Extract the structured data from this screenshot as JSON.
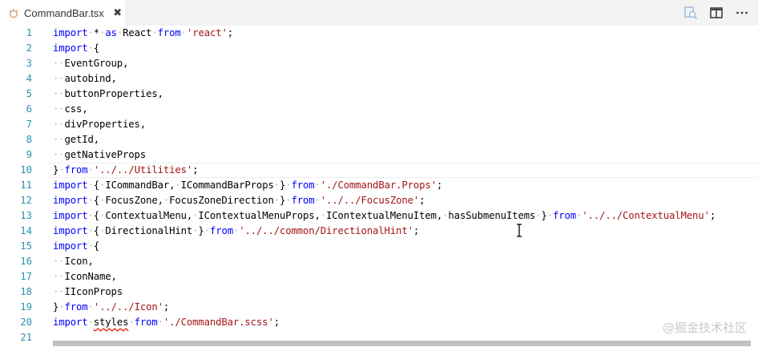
{
  "tab": {
    "label": "CommandBar.tsx",
    "close_glyph": "✖",
    "file_icon": "typescript-file-icon"
  },
  "actions": {
    "compare_icon": "open-changes-icon",
    "split_icon": "split-editor-icon"
  },
  "editor": {
    "lines": [
      {
        "n": "1",
        "tokens": [
          [
            "kw",
            "import"
          ],
          [
            "ws",
            "·"
          ],
          [
            "t",
            "*"
          ],
          [
            "ws",
            "·"
          ],
          [
            "kw",
            "as"
          ],
          [
            "ws",
            "·"
          ],
          [
            "t",
            "React"
          ],
          [
            "ws",
            "·"
          ],
          [
            "kw",
            "from"
          ],
          [
            "ws",
            "·"
          ],
          [
            "str",
            "'react'"
          ],
          [
            "t",
            ";"
          ]
        ]
      },
      {
        "n": "2",
        "tokens": [
          [
            "kw",
            "import"
          ],
          [
            "ws",
            "·"
          ],
          [
            "t",
            "{"
          ]
        ]
      },
      {
        "n": "3",
        "tokens": [
          [
            "ws",
            "··"
          ],
          [
            "t",
            "EventGroup,"
          ]
        ]
      },
      {
        "n": "4",
        "tokens": [
          [
            "ws",
            "··"
          ],
          [
            "t",
            "autobind,"
          ]
        ]
      },
      {
        "n": "5",
        "tokens": [
          [
            "ws",
            "··"
          ],
          [
            "t",
            "buttonProperties,"
          ]
        ]
      },
      {
        "n": "6",
        "tokens": [
          [
            "ws",
            "··"
          ],
          [
            "t",
            "css,"
          ]
        ]
      },
      {
        "n": "7",
        "tokens": [
          [
            "ws",
            "··"
          ],
          [
            "t",
            "divProperties,"
          ]
        ]
      },
      {
        "n": "8",
        "tokens": [
          [
            "ws",
            "··"
          ],
          [
            "t",
            "getId,"
          ]
        ]
      },
      {
        "n": "9",
        "tokens": [
          [
            "ws",
            "··"
          ],
          [
            "t",
            "getNativeProps"
          ]
        ]
      },
      {
        "n": "10",
        "tokens": [
          [
            "t",
            "}"
          ],
          [
            "ws",
            "·"
          ],
          [
            "kw",
            "from"
          ],
          [
            "ws",
            "·"
          ],
          [
            "str",
            "'../../Utilities'"
          ],
          [
            "t",
            ";"
          ]
        ]
      },
      {
        "n": "11",
        "tokens": [
          [
            "kw",
            "import"
          ],
          [
            "ws",
            "·"
          ],
          [
            "t",
            "{"
          ],
          [
            "ws",
            "·"
          ],
          [
            "t",
            "ICommandBar,"
          ],
          [
            "ws",
            "·"
          ],
          [
            "t",
            "ICommandBarProps"
          ],
          [
            "ws",
            "·"
          ],
          [
            "t",
            "}"
          ],
          [
            "ws",
            "·"
          ],
          [
            "kw",
            "from"
          ],
          [
            "ws",
            "·"
          ],
          [
            "str",
            "'./CommandBar.Props'"
          ],
          [
            "t",
            ";"
          ]
        ]
      },
      {
        "n": "12",
        "tokens": [
          [
            "kw",
            "import"
          ],
          [
            "ws",
            "·"
          ],
          [
            "t",
            "{"
          ],
          [
            "ws",
            "·"
          ],
          [
            "t",
            "FocusZone,"
          ],
          [
            "ws",
            "·"
          ],
          [
            "t",
            "FocusZoneDirection"
          ],
          [
            "ws",
            "·"
          ],
          [
            "t",
            "}"
          ],
          [
            "ws",
            "·"
          ],
          [
            "kw",
            "from"
          ],
          [
            "ws",
            "·"
          ],
          [
            "str",
            "'../../FocusZone'"
          ],
          [
            "t",
            ";"
          ]
        ]
      },
      {
        "n": "13",
        "tokens": [
          [
            "kw",
            "import"
          ],
          [
            "ws",
            "·"
          ],
          [
            "t",
            "{"
          ],
          [
            "ws",
            "·"
          ],
          [
            "t",
            "ContextualMenu,"
          ],
          [
            "ws",
            "·"
          ],
          [
            "t",
            "IContextualMenuProps,"
          ],
          [
            "ws",
            "·"
          ],
          [
            "t",
            "IContextualMenuItem,"
          ],
          [
            "ws",
            "·"
          ],
          [
            "t",
            "hasSubmenuItems"
          ],
          [
            "ws",
            "·"
          ],
          [
            "t",
            "}"
          ],
          [
            "ws",
            "·"
          ],
          [
            "kw",
            "from"
          ],
          [
            "ws",
            "·"
          ],
          [
            "str",
            "'../../ContextualMenu'"
          ],
          [
            "t",
            ";"
          ]
        ]
      },
      {
        "n": "14",
        "tokens": [
          [
            "kw",
            "import"
          ],
          [
            "ws",
            "·"
          ],
          [
            "t",
            "{"
          ],
          [
            "ws",
            "·"
          ],
          [
            "t",
            "DirectionalHint"
          ],
          [
            "ws",
            "·"
          ],
          [
            "t",
            "}"
          ],
          [
            "ws",
            "·"
          ],
          [
            "kw",
            "from"
          ],
          [
            "ws",
            "·"
          ],
          [
            "str",
            "'../../common/DirectionalHint'"
          ],
          [
            "t",
            ";"
          ]
        ]
      },
      {
        "n": "15",
        "tokens": [
          [
            "kw",
            "import"
          ],
          [
            "ws",
            "·"
          ],
          [
            "t",
            "{"
          ]
        ]
      },
      {
        "n": "16",
        "tokens": [
          [
            "ws",
            "··"
          ],
          [
            "t",
            "Icon,"
          ]
        ]
      },
      {
        "n": "17",
        "tokens": [
          [
            "ws",
            "··"
          ],
          [
            "t",
            "IconName,"
          ]
        ]
      },
      {
        "n": "18",
        "tokens": [
          [
            "ws",
            "··"
          ],
          [
            "t",
            "IIconProps"
          ]
        ]
      },
      {
        "n": "19",
        "tokens": [
          [
            "t",
            "}"
          ],
          [
            "ws",
            "·"
          ],
          [
            "kw",
            "from"
          ],
          [
            "ws",
            "·"
          ],
          [
            "str",
            "'../../Icon'"
          ],
          [
            "t",
            ";"
          ]
        ]
      },
      {
        "n": "20",
        "tokens": [
          [
            "kw",
            "import"
          ],
          [
            "ws",
            "·"
          ],
          [
            "sq",
            "styles"
          ],
          [
            "ws",
            "·"
          ],
          [
            "kw",
            "from"
          ],
          [
            "ws",
            "·"
          ],
          [
            "str",
            "'./CommandBar.scss'"
          ],
          [
            "t",
            ";"
          ]
        ]
      },
      {
        "n": "21",
        "tokens": []
      }
    ]
  },
  "watermark": "@掘金技术社区",
  "colors": {
    "keyword": "#0000ff",
    "string": "#a31515",
    "line_number": "#2b91af",
    "whitespace": "#b3b3b3",
    "error_squiggle": "#e51400"
  }
}
